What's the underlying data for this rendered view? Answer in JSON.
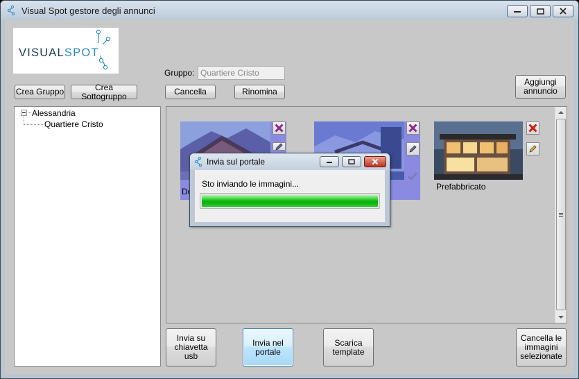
{
  "window": {
    "title": "Visual Spot gestore degli annunci"
  },
  "logo": {
    "part1": "VISUAL",
    "part2": "SPOT"
  },
  "group": {
    "label": "Gruppo:",
    "value": "Quartiere Cristo"
  },
  "buttons": {
    "crea_gruppo": "Crea Gruppo",
    "crea_sottogruppo": "Crea Sottogruppo",
    "cancella": "Cancella",
    "rinomina": "Rinomina",
    "aggiungi_annuncio": [
      "Aggiungi",
      "annuncio"
    ],
    "invia_usb": [
      "Invia su",
      "chiavetta",
      "usb"
    ],
    "invia_portale": [
      "Invia nel",
      "portale"
    ],
    "scarica_template": [
      "Scarica",
      "template"
    ],
    "cancella_immagini": [
      "Cancella le",
      "immagini",
      "selezionate"
    ]
  },
  "tree": {
    "root": "Alessandria",
    "child": "Quartiere Cristo"
  },
  "gallery": {
    "items": [
      {
        "label": "De",
        "selected": true
      },
      {
        "label": "",
        "selected": true
      },
      {
        "label": "Prefabbricato",
        "selected": false
      }
    ]
  },
  "dialog": {
    "title": "Invia sul portale",
    "message": "Sto inviando le immagini...",
    "progress": 1.0
  },
  "colors": {
    "selection": "#8a8ae0",
    "progress": "#06b006",
    "logo_dark": "#1c3a5c",
    "logo_light": "#2a8ac8"
  },
  "icons": [
    "app-icon",
    "minimize-icon",
    "maximize-icon",
    "close-icon",
    "delete-x-icon",
    "pencil-icon",
    "check-icon"
  ]
}
